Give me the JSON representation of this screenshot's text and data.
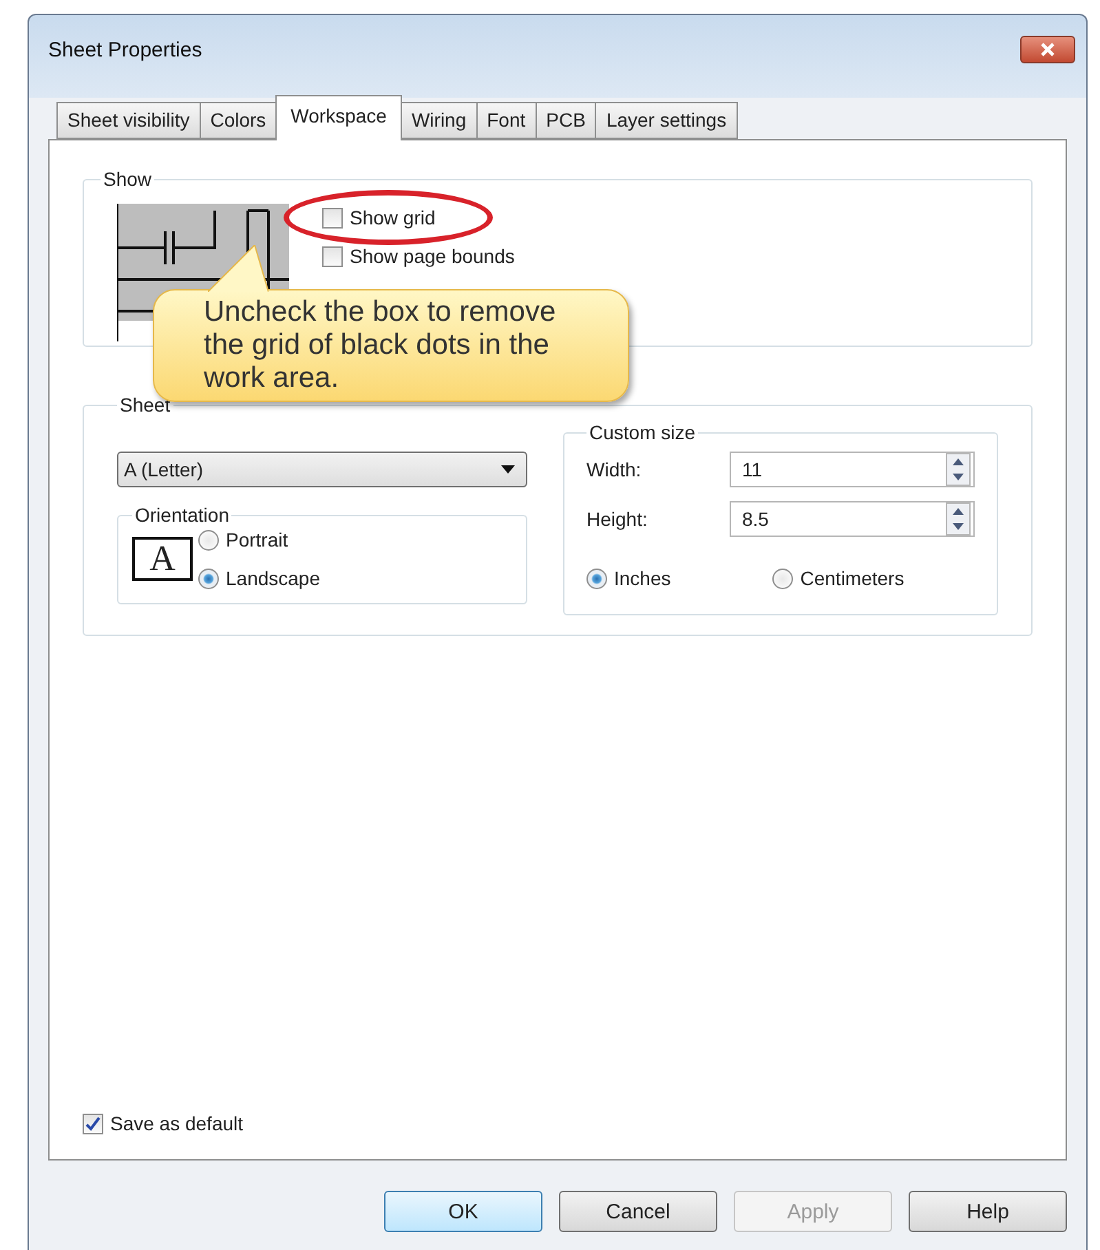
{
  "window": {
    "title": "Sheet Properties"
  },
  "tabs": [
    {
      "label": "Sheet visibility",
      "selected": false
    },
    {
      "label": "Colors",
      "selected": false
    },
    {
      "label": "Workspace",
      "selected": true
    },
    {
      "label": "Wiring",
      "selected": false
    },
    {
      "label": "Font",
      "selected": false
    },
    {
      "label": "PCB",
      "selected": false
    },
    {
      "label": "Layer settings",
      "selected": false
    }
  ],
  "show_group": {
    "label": "Show",
    "options": [
      {
        "label": "Show grid",
        "checked": false,
        "highlighted": true
      },
      {
        "label": "Show page bounds",
        "checked": false,
        "highlighted": false
      }
    ]
  },
  "callout": {
    "text": "Uncheck the box to remove the grid of black dots in the work area."
  },
  "sheet_group": {
    "label": "Sheet",
    "size_select": {
      "value": "A (Letter)"
    },
    "orientation": {
      "label": "Orientation",
      "icon_letter": "A",
      "options": [
        {
          "label": "Portrait",
          "selected": false
        },
        {
          "label": "Landscape",
          "selected": true
        }
      ]
    },
    "custom_size": {
      "label": "Custom size",
      "fields": [
        {
          "label": "Width:",
          "value": "11"
        },
        {
          "label": "Height:",
          "value": "8.5"
        }
      ],
      "units": [
        {
          "label": "Inches",
          "selected": true
        },
        {
          "label": "Centimeters",
          "selected": false
        }
      ]
    }
  },
  "save_default": {
    "label": "Save as default",
    "checked": true
  },
  "buttons": [
    {
      "label": "OK",
      "default": true,
      "disabled": false
    },
    {
      "label": "Cancel",
      "default": false,
      "disabled": false
    },
    {
      "label": "Apply",
      "default": false,
      "disabled": true
    },
    {
      "label": "Help",
      "default": false,
      "disabled": false
    }
  ]
}
